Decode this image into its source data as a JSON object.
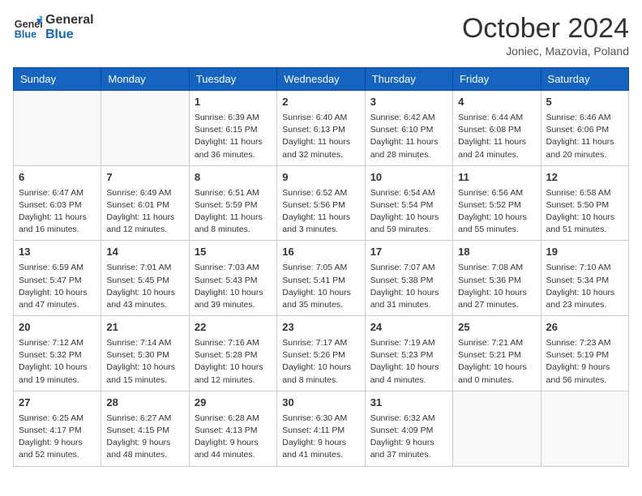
{
  "header": {
    "logo_line1": "General",
    "logo_line2": "Blue",
    "month": "October 2024",
    "location": "Joniec, Mazovia, Poland"
  },
  "weekdays": [
    "Sunday",
    "Monday",
    "Tuesday",
    "Wednesday",
    "Thursday",
    "Friday",
    "Saturday"
  ],
  "weeks": [
    [
      {
        "day": "",
        "info": ""
      },
      {
        "day": "",
        "info": ""
      },
      {
        "day": "1",
        "info": "Sunrise: 6:39 AM\nSunset: 6:15 PM\nDaylight: 11 hours and 36 minutes."
      },
      {
        "day": "2",
        "info": "Sunrise: 6:40 AM\nSunset: 6:13 PM\nDaylight: 11 hours and 32 minutes."
      },
      {
        "day": "3",
        "info": "Sunrise: 6:42 AM\nSunset: 6:10 PM\nDaylight: 11 hours and 28 minutes."
      },
      {
        "day": "4",
        "info": "Sunrise: 6:44 AM\nSunset: 6:08 PM\nDaylight: 11 hours and 24 minutes."
      },
      {
        "day": "5",
        "info": "Sunrise: 6:46 AM\nSunset: 6:06 PM\nDaylight: 11 hours and 20 minutes."
      }
    ],
    [
      {
        "day": "6",
        "info": "Sunrise: 6:47 AM\nSunset: 6:03 PM\nDaylight: 11 hours and 16 minutes."
      },
      {
        "day": "7",
        "info": "Sunrise: 6:49 AM\nSunset: 6:01 PM\nDaylight: 11 hours and 12 minutes."
      },
      {
        "day": "8",
        "info": "Sunrise: 6:51 AM\nSunset: 5:59 PM\nDaylight: 11 hours and 8 minutes."
      },
      {
        "day": "9",
        "info": "Sunrise: 6:52 AM\nSunset: 5:56 PM\nDaylight: 11 hours and 3 minutes."
      },
      {
        "day": "10",
        "info": "Sunrise: 6:54 AM\nSunset: 5:54 PM\nDaylight: 10 hours and 59 minutes."
      },
      {
        "day": "11",
        "info": "Sunrise: 6:56 AM\nSunset: 5:52 PM\nDaylight: 10 hours and 55 minutes."
      },
      {
        "day": "12",
        "info": "Sunrise: 6:58 AM\nSunset: 5:50 PM\nDaylight: 10 hours and 51 minutes."
      }
    ],
    [
      {
        "day": "13",
        "info": "Sunrise: 6:59 AM\nSunset: 5:47 PM\nDaylight: 10 hours and 47 minutes."
      },
      {
        "day": "14",
        "info": "Sunrise: 7:01 AM\nSunset: 5:45 PM\nDaylight: 10 hours and 43 minutes."
      },
      {
        "day": "15",
        "info": "Sunrise: 7:03 AM\nSunset: 5:43 PM\nDaylight: 10 hours and 39 minutes."
      },
      {
        "day": "16",
        "info": "Sunrise: 7:05 AM\nSunset: 5:41 PM\nDaylight: 10 hours and 35 minutes."
      },
      {
        "day": "17",
        "info": "Sunrise: 7:07 AM\nSunset: 5:38 PM\nDaylight: 10 hours and 31 minutes."
      },
      {
        "day": "18",
        "info": "Sunrise: 7:08 AM\nSunset: 5:36 PM\nDaylight: 10 hours and 27 minutes."
      },
      {
        "day": "19",
        "info": "Sunrise: 7:10 AM\nSunset: 5:34 PM\nDaylight: 10 hours and 23 minutes."
      }
    ],
    [
      {
        "day": "20",
        "info": "Sunrise: 7:12 AM\nSunset: 5:32 PM\nDaylight: 10 hours and 19 minutes."
      },
      {
        "day": "21",
        "info": "Sunrise: 7:14 AM\nSunset: 5:30 PM\nDaylight: 10 hours and 15 minutes."
      },
      {
        "day": "22",
        "info": "Sunrise: 7:16 AM\nSunset: 5:28 PM\nDaylight: 10 hours and 12 minutes."
      },
      {
        "day": "23",
        "info": "Sunrise: 7:17 AM\nSunset: 5:26 PM\nDaylight: 10 hours and 8 minutes."
      },
      {
        "day": "24",
        "info": "Sunrise: 7:19 AM\nSunset: 5:23 PM\nDaylight: 10 hours and 4 minutes."
      },
      {
        "day": "25",
        "info": "Sunrise: 7:21 AM\nSunset: 5:21 PM\nDaylight: 10 hours and 0 minutes."
      },
      {
        "day": "26",
        "info": "Sunrise: 7:23 AM\nSunset: 5:19 PM\nDaylight: 9 hours and 56 minutes."
      }
    ],
    [
      {
        "day": "27",
        "info": "Sunrise: 6:25 AM\nSunset: 4:17 PM\nDaylight: 9 hours and 52 minutes."
      },
      {
        "day": "28",
        "info": "Sunrise: 6:27 AM\nSunset: 4:15 PM\nDaylight: 9 hours and 48 minutes."
      },
      {
        "day": "29",
        "info": "Sunrise: 6:28 AM\nSunset: 4:13 PM\nDaylight: 9 hours and 44 minutes."
      },
      {
        "day": "30",
        "info": "Sunrise: 6:30 AM\nSunset: 4:11 PM\nDaylight: 9 hours and 41 minutes."
      },
      {
        "day": "31",
        "info": "Sunrise: 6:32 AM\nSunset: 4:09 PM\nDaylight: 9 hours and 37 minutes."
      },
      {
        "day": "",
        "info": ""
      },
      {
        "day": "",
        "info": ""
      }
    ]
  ]
}
